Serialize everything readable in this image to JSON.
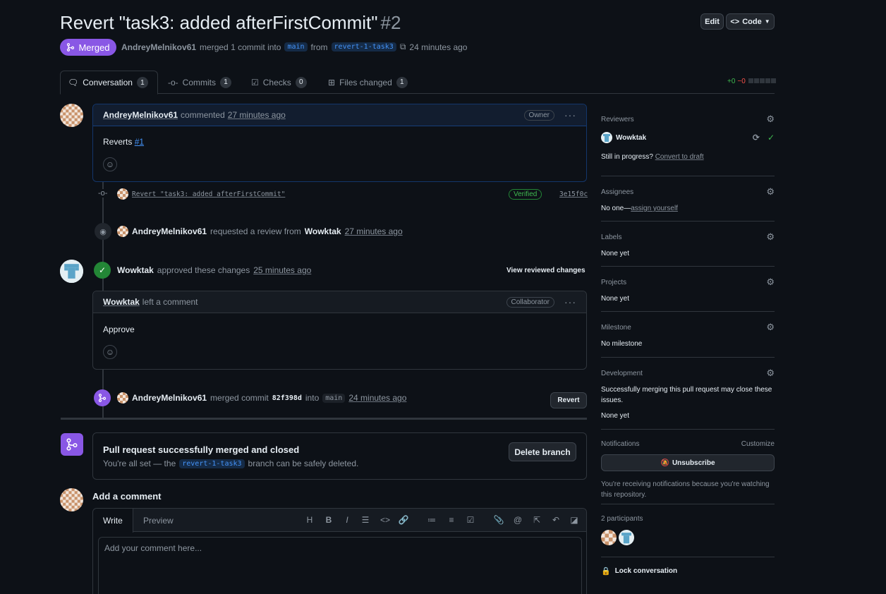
{
  "header": {
    "title": "Revert \"task3: added afterFirstCommit\"",
    "number": "#2",
    "edit_label": "Edit",
    "code_label": "Code",
    "state_label": "Merged",
    "author": "AndreyMelnikov61",
    "merged_text": "merged 1 commit into",
    "base_branch": "main",
    "from_text": "from",
    "head_branch": "revert-1-task3",
    "time": "24 minutes ago"
  },
  "tabs": [
    {
      "label": "Conversation",
      "count": "1"
    },
    {
      "label": "Commits",
      "count": "1"
    },
    {
      "label": "Checks",
      "count": "0"
    },
    {
      "label": "Files changed",
      "count": "1"
    }
  ],
  "diffstat": {
    "added": "+0",
    "removed": "−0"
  },
  "timeline": {
    "first_comment": {
      "author": "AndreyMelnikov61",
      "action": "commented",
      "time": "27 minutes ago",
      "role": "Owner",
      "body_prefix": "Reverts",
      "body_link": "#1"
    },
    "commit": {
      "message": "Revert \"task3: added afterFirstCommit\"",
      "verified": "Verified",
      "sha": "3e15f0c"
    },
    "review_request": {
      "author": "AndreyMelnikov61",
      "text": "requested a review from",
      "reviewer": "Wowktak",
      "time": "27 minutes ago"
    },
    "approval": {
      "author": "Wowktak",
      "text": "approved these changes",
      "time": "25 minutes ago",
      "view_label": "View reviewed changes"
    },
    "review_comment": {
      "author": "Wowktak",
      "action": "left a comment",
      "role": "Collaborator",
      "body": "Approve"
    },
    "merge_event": {
      "author": "AndreyMelnikov61",
      "text": "merged commit",
      "sha": "82f398d",
      "into": "into",
      "branch": "main",
      "time": "24 minutes ago",
      "revert_label": "Revert"
    }
  },
  "merge_box": {
    "title": "Pull request successfully merged and closed",
    "desc_prefix": "You're all set — the",
    "branch": "revert-1-task3",
    "desc_suffix": "branch can be safely deleted.",
    "delete_label": "Delete branch"
  },
  "add_comment": {
    "title": "Add a comment",
    "write_tab": "Write",
    "preview_tab": "Preview",
    "placeholder": "Add your comment here..."
  },
  "sidebar": {
    "reviewers": {
      "title": "Reviewers",
      "name": "Wowktak",
      "progress": "Still in progress?",
      "draft_link": "Convert to draft"
    },
    "assignees": {
      "title": "Assignees",
      "value": "No one—",
      "link": "assign yourself"
    },
    "labels": {
      "title": "Labels",
      "value": "None yet"
    },
    "projects": {
      "title": "Projects",
      "value": "None yet"
    },
    "milestone": {
      "title": "Milestone",
      "value": "No milestone"
    },
    "development": {
      "title": "Development",
      "desc": "Successfully merging this pull request may close these issues.",
      "value": "None yet"
    },
    "notifications": {
      "title": "Notifications",
      "customize": "Customize",
      "button": "Unsubscribe",
      "desc": "You're receiving notifications because you're watching this repository."
    },
    "participants": {
      "title": "2 participants"
    },
    "lock": "Lock conversation"
  },
  "colors": {
    "accent_purple": "#8957e5",
    "success_green": "#238636",
    "link_blue": "#4493f8",
    "bg": "#0d1117"
  }
}
